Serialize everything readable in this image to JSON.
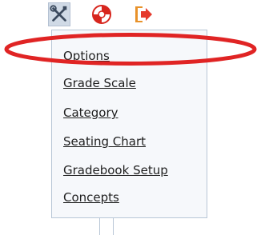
{
  "toolbar": {
    "icons": [
      "settings-icon",
      "help-lifebuoy-icon",
      "exit-icon"
    ]
  },
  "menu": {
    "items": [
      {
        "label": "Options"
      },
      {
        "label": "Grade Scale"
      },
      {
        "label": "Category"
      },
      {
        "label": "Seating Chart"
      },
      {
        "label": "Gradebook Setup"
      },
      {
        "label": "Concepts"
      }
    ]
  },
  "colors": {
    "annotation": "#e02424",
    "menu_border": "#b8c6d6",
    "menu_bg": "#f6f8fb",
    "active_button_bg": "#d0dae6",
    "help_icon": "#d7261e",
    "exit_icon_red": "#e5392c",
    "exit_icon_orange": "#e8922a"
  }
}
